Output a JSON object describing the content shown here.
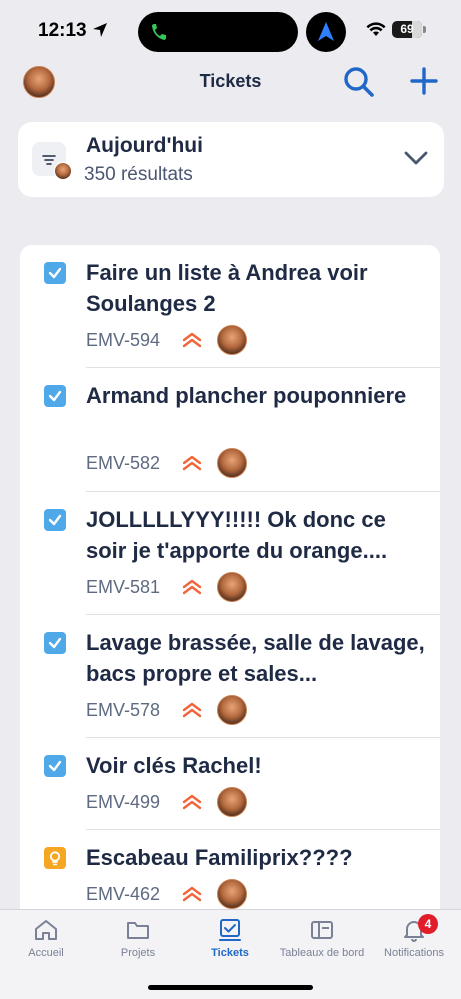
{
  "status_bar": {
    "time": "12:13",
    "battery": "69"
  },
  "header": {
    "title": "Tickets"
  },
  "filter": {
    "title": "Aujourd'hui",
    "count": "350 résultats"
  },
  "tickets": [
    {
      "summary": "Faire un liste à Andrea voir Soulanges 2",
      "key": "EMV-594",
      "type": "task",
      "priority": "high"
    },
    {
      "summary": "Armand plancher pouponniere",
      "key": "EMV-582",
      "type": "task",
      "priority": "high"
    },
    {
      "summary": "JOLLLLLYYY!!!!! Ok donc ce soir je t'apporte du orange....",
      "key": "EMV-581",
      "type": "task",
      "priority": "high"
    },
    {
      "summary": "Lavage brassée, salle de lavage, bacs propre et sales...",
      "key": "EMV-578",
      "type": "task",
      "priority": "high"
    },
    {
      "summary": "Voir clés Rachel!",
      "key": "EMV-499",
      "type": "task",
      "priority": "high"
    },
    {
      "summary": "Escabeau Familiprix????",
      "key": "EMV-462",
      "type": "idea",
      "priority": "high"
    }
  ],
  "tabs": [
    {
      "label": "Accueil",
      "icon": "home-icon"
    },
    {
      "label": "Projets",
      "icon": "folder-icon"
    },
    {
      "label": "Tickets",
      "icon": "tickets-icon",
      "active": true
    },
    {
      "label": "Tableaux de bord",
      "icon": "dashboard-icon"
    },
    {
      "label": "Notifications",
      "icon": "bell-icon",
      "badge": "4"
    }
  ],
  "colors": {
    "accent": "#2167c7",
    "task": "#4fa8e8",
    "idea": "#f5a623",
    "priority_high": "#f2653a",
    "badge": "#e11d2a"
  }
}
